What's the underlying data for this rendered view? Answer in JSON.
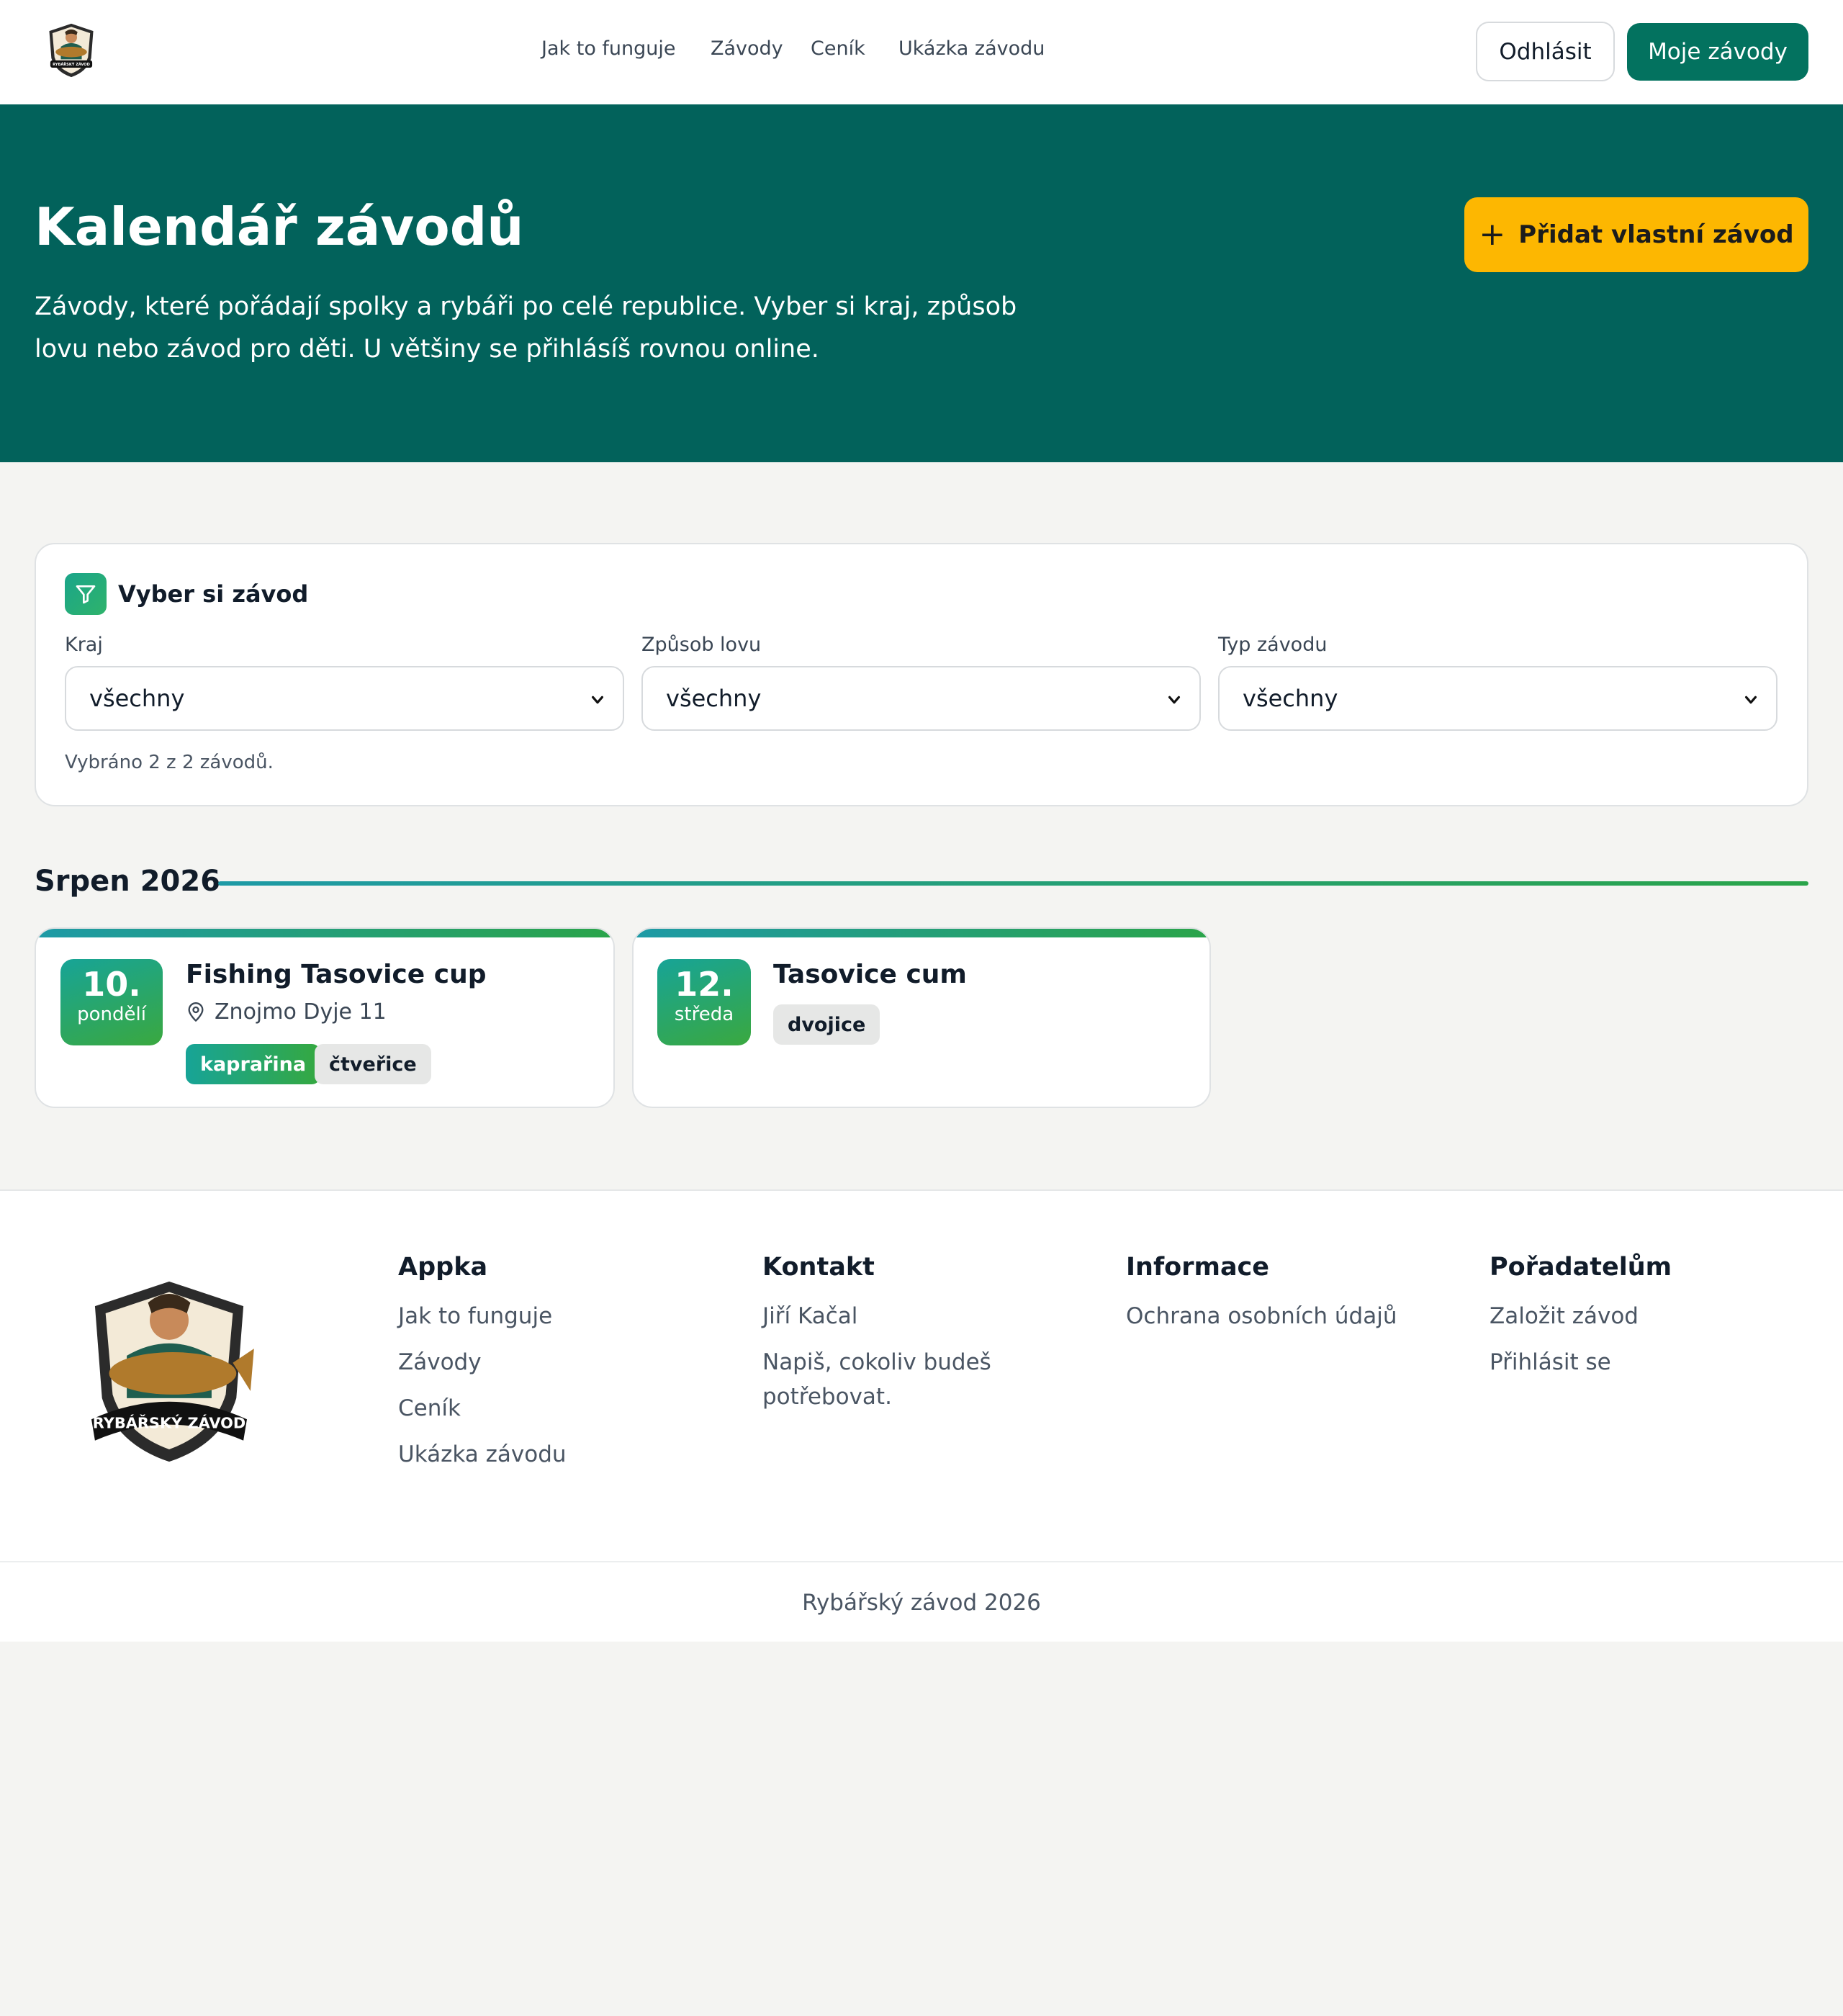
{
  "header": {
    "logo_text": "RYBÁŘSKÝ ZÁVOD",
    "nav": [
      "Jak to funguje",
      "Závody",
      "Ceník",
      "Ukázka závodu"
    ],
    "logout_label": "Odhlásit",
    "my_races_label": "Moje závody"
  },
  "hero": {
    "title": "Kalendář závodů",
    "description": "Závody, které pořádají spolky a rybáři po celé republice. Vyber si kraj, způsob lovu nebo závod pro děti. U většiny se přihlásíš rovnou online.",
    "add_button_label": "Přidat vlastní závod"
  },
  "filter": {
    "title": "Vyber si závod",
    "fields": [
      {
        "label": "Kraj",
        "value": "všechny"
      },
      {
        "label": "Způsob lovu",
        "value": "všechny"
      },
      {
        "label": "Typ závodu",
        "value": "všechny"
      }
    ],
    "count_text": "Vybráno 2 z 2 závodů."
  },
  "month": {
    "title": "Srpen 2026",
    "races": [
      {
        "day": "10.",
        "weekday": "pondělí",
        "name": "Fishing Tasovice cup",
        "location": "Znojmo Dyje 11",
        "tags": [
          "kaprařina",
          "čtveřice"
        ]
      },
      {
        "day": "12.",
        "weekday": "středa",
        "name": "Tasovice cum",
        "location": "",
        "tags": [
          "dvojice"
        ]
      }
    ]
  },
  "footer": {
    "logo_text": "RYBÁŘSKÝ ZÁVOD",
    "columns": [
      {
        "title": "Appka",
        "links": [
          "Jak to funguje",
          "Závody",
          "Ceník",
          "Ukázka závodu"
        ]
      },
      {
        "title": "Kontakt",
        "links": [
          "Jiří Kačal",
          "Napiš, cokoliv budeš potřebovat."
        ]
      },
      {
        "title": "Informace",
        "links": [
          "Ochrana osobních údajů"
        ]
      },
      {
        "title": "Pořadatelům",
        "links": [
          "Založit závod",
          "Přihlásit se"
        ]
      }
    ],
    "copyright": "Rybářský závod 2026"
  },
  "colors": {
    "brand_dark": "#02625b",
    "brand_button": "#03725f",
    "accent_yellow": "#fdb701",
    "gradient_start": "#1e9aa6",
    "gradient_end": "#2aa44a"
  }
}
